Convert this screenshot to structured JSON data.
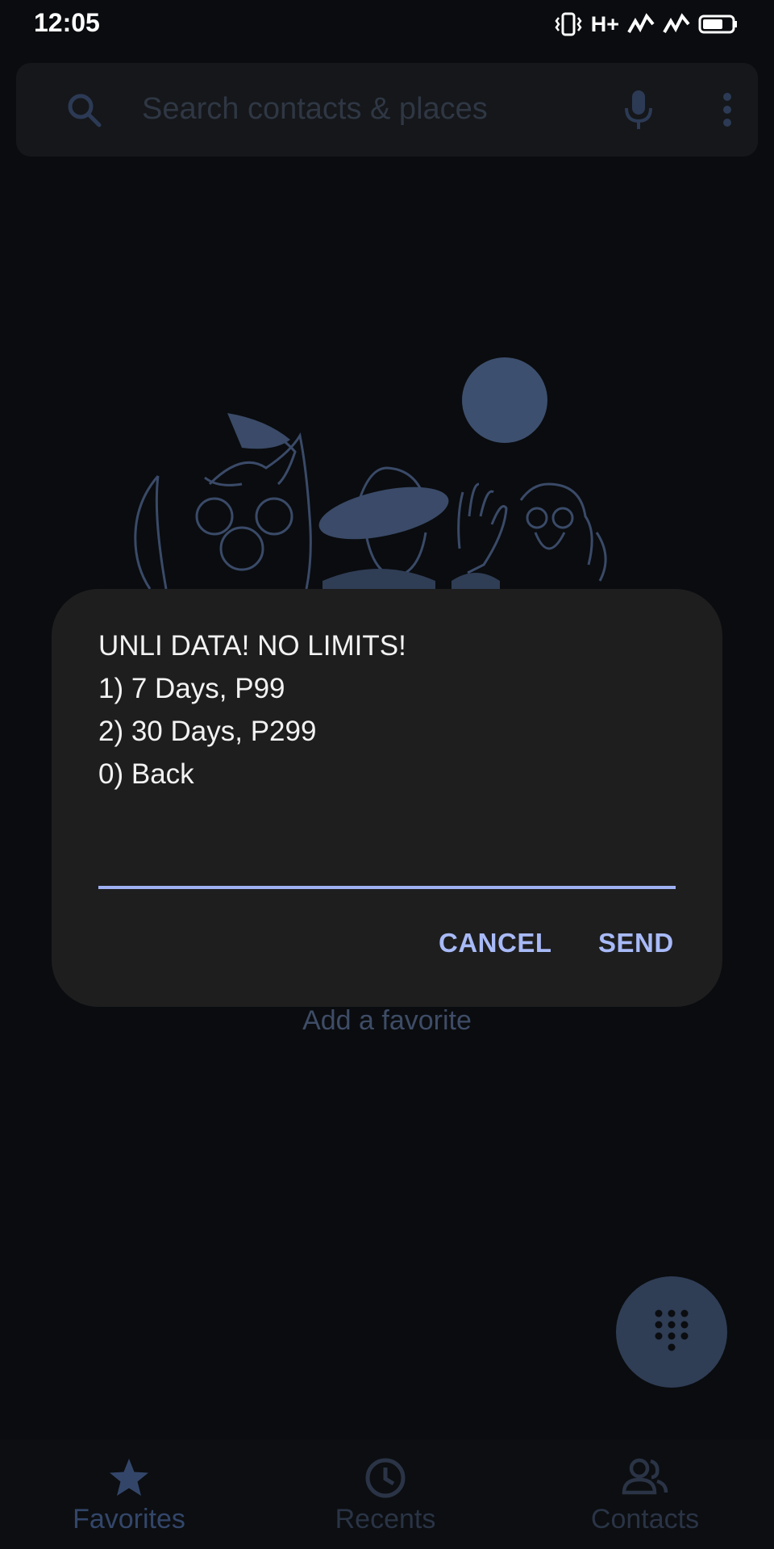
{
  "status_bar": {
    "time": "12:05",
    "network": "H+"
  },
  "search": {
    "placeholder": "Search contacts & places"
  },
  "empty_state": {
    "add_favorite": "Add a favorite"
  },
  "dialog": {
    "lines": [
      "UNLI DATA! NO LIMITS!",
      "1) 7 Days, P99",
      "2) 30 Days, P299",
      "0) Back"
    ],
    "input_value": "",
    "cancel_label": "CANCEL",
    "send_label": "SEND"
  },
  "bottom_nav": {
    "favorites_label": "Favorites",
    "recents_label": "Recents",
    "contacts_label": "Contacts"
  },
  "icons": {
    "search": "search-icon",
    "mic": "mic-icon",
    "more": "more-vert-icon",
    "dialpad": "dialpad-icon",
    "star": "star-icon",
    "clock": "clock-icon",
    "people": "people-icon"
  },
  "colors": {
    "background": "#0a0c0f",
    "dialog": "#1e1e1f",
    "accent": "#a8baf7",
    "muted": "#3e4c66"
  }
}
